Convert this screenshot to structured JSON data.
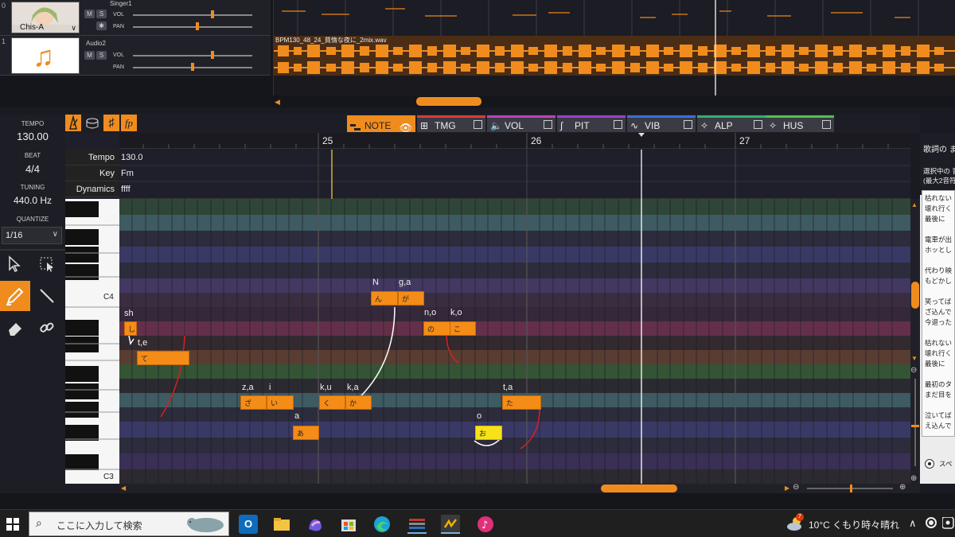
{
  "tracks": [
    {
      "number": "0",
      "name": "Singer1",
      "thumb_label": "Chis-A",
      "vol_label": "VOL",
      "pan_label": "PAN",
      "mute": "M",
      "solo": "S",
      "vol": 0.82,
      "pan": 0.62
    },
    {
      "number": "1",
      "name": "Audio2",
      "thumb_label": "♫",
      "vol_label": "VOL",
      "pan_label": "PAN",
      "mute": "M",
      "solo": "S",
      "vol": 0.82,
      "pan": 0.56
    }
  ],
  "audio_clip": {
    "title": "BPM130_48_24_貧惰な夜に_2mix.wav"
  },
  "left_panel": {
    "tempo_label": "TEMPO",
    "tempo_value": "130.00",
    "beat_label": "BEAT",
    "beat_value": "4/4",
    "tuning_label": "TUNING",
    "tuning_value": "440.0 Hz",
    "quantize_label": "QUANTIZE",
    "quantize_value": "1/16"
  },
  "tabs": [
    {
      "label": "NOTE",
      "color": "#f08c1e",
      "active": true
    },
    {
      "label": "TMG",
      "color": "#e03a3a",
      "active": false
    },
    {
      "label": "VOL",
      "color": "#c040c0",
      "active": false
    },
    {
      "label": "PIT",
      "color": "#9a40d0",
      "active": false
    },
    {
      "label": "VIB",
      "color": "#3a70e0",
      "active": false
    },
    {
      "label": "ALP",
      "color": "#30b070",
      "active": false
    },
    {
      "label": "HUS",
      "color": "#50c050",
      "active": false
    }
  ],
  "ruler": {
    "bars": [
      "25",
      "26",
      "27"
    ]
  },
  "meta": {
    "tempo_label": "Tempo",
    "tempo_value": "130.0",
    "key_label": "Key",
    "key_value": "Fm",
    "dynamics_label": "Dynamics",
    "dynamics_value": "ffff"
  },
  "key_labels": {
    "c4": "C4",
    "c3": "C3"
  },
  "notes": [
    {
      "phoneme": "sh",
      "kana": "し"
    },
    {
      "phoneme": "t,e",
      "kana": "て"
    },
    {
      "phoneme": "z,a",
      "kana": "ざ"
    },
    {
      "phoneme": "i",
      "kana": "い"
    },
    {
      "phoneme": "a",
      "kana": "あ"
    },
    {
      "phoneme": "k,u",
      "kana": "く"
    },
    {
      "phoneme": "k,a",
      "kana": "か"
    },
    {
      "phoneme": "N",
      "kana": "ん"
    },
    {
      "phoneme": "g,a",
      "kana": "が"
    },
    {
      "phoneme": "n,o",
      "kana": "の"
    },
    {
      "phoneme": "k,o",
      "kana": "こ"
    },
    {
      "phoneme": "o",
      "kana": "お"
    },
    {
      "phoneme": "t,a",
      "kana": "た"
    }
  ],
  "right_panel": {
    "title": "歌詞の ま",
    "subtitle1": "選択中の 音",
    "subtitle2": "(最大2音符",
    "lines": [
      "枯れない",
      "壊れ行く",
      "最後に",
      "",
      "電車が出",
      "ホッとし",
      "",
      "代わり映",
      "もどかし",
      "",
      "笑ってば",
      "ざ込んで",
      "今退った",
      "",
      "枯れない",
      "壊れ行く",
      "最後に",
      "",
      "最初のタ",
      "まだ目を",
      "",
      "泣いてば",
      "え込んで"
    ],
    "space_label": "スペ"
  },
  "taskbar": {
    "search_placeholder": "ここに入力して検索",
    "weather": "10°C くもり時々晴れ",
    "badge": "7"
  }
}
